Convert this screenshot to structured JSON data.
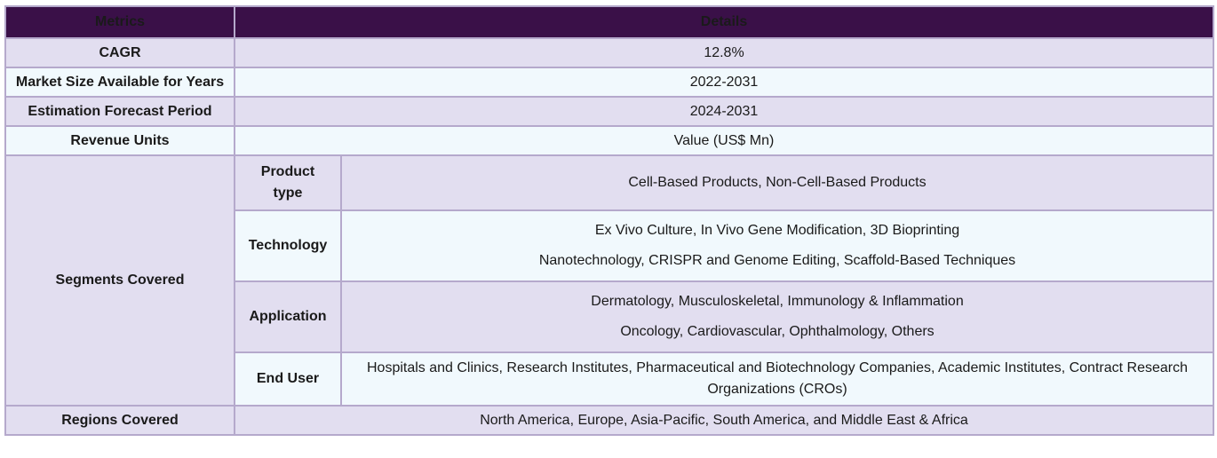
{
  "header": {
    "metrics": "Metrics",
    "details": "Details"
  },
  "rows": {
    "cagr": {
      "label": "CAGR",
      "value": "12.8%"
    },
    "market_size": {
      "label": "Market Size Available for Years",
      "value": "2022-2031"
    },
    "forecast": {
      "label": "Estimation Forecast Period",
      "value": "2024-2031"
    },
    "revenue": {
      "label": "Revenue Units",
      "value": "Value (US$ Mn)"
    },
    "segments": {
      "label": "Segments Covered",
      "product_type": {
        "label_1": "Product",
        "label_2": "type",
        "line1": "Cell-Based Products, Non-Cell-Based Products"
      },
      "technology": {
        "label": "Technology",
        "line1": "Ex Vivo Culture, In Vivo Gene Modification, 3D Bioprinting",
        "line2": "Nanotechnology, CRISPR and Genome Editing, Scaffold-Based Techniques"
      },
      "application": {
        "label": "Application",
        "line1": "Dermatology, Musculoskeletal, Immunology & Inflammation",
        "line2": "Oncology, Cardiovascular, Ophthalmology, Others"
      },
      "end_user": {
        "label": "End User",
        "line1": "Hospitals and Clinics, Research Institutes, Pharmaceutical and Biotechnology Companies, Academic Institutes, Contract Research",
        "line2": "Organizations (CROs)"
      }
    },
    "regions": {
      "label": "Regions Covered",
      "value": "North America, Europe, Asia-Pacific, South America, and Middle East & Africa"
    }
  }
}
